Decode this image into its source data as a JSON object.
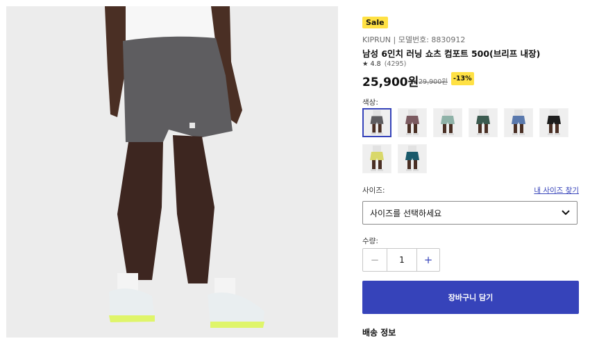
{
  "product": {
    "badge": "Sale",
    "brand_line": "KIPRUN | 모델번호: 8830912",
    "title": "남성 6인치 러닝 쇼츠 컴포트 500(브리프 내장)",
    "rating": "★ 4.8",
    "review_count": "(4295)",
    "price": "25,900원",
    "old_price": "29,900원",
    "discount": "-13%"
  },
  "color": {
    "label": "색상:",
    "swatches": [
      {
        "name": "swatch-1",
        "shorts": "#5e5d60",
        "selected": true
      },
      {
        "name": "swatch-2",
        "shorts": "#7b5a60",
        "selected": false
      },
      {
        "name": "swatch-3",
        "shorts": "#8fb2a8",
        "selected": false
      },
      {
        "name": "swatch-4",
        "shorts": "#3b5a4f",
        "selected": false
      },
      {
        "name": "swatch-5",
        "shorts": "#5a79ad",
        "selected": false
      },
      {
        "name": "swatch-6",
        "shorts": "#1c1c1c",
        "selected": false
      },
      {
        "name": "swatch-7",
        "shorts": "#d9d86a",
        "selected": false
      },
      {
        "name": "swatch-8",
        "shorts": "#1a5a6b",
        "selected": false
      }
    ]
  },
  "size": {
    "label": "사이즈:",
    "guide_link": "내 사이즈 찾기",
    "placeholder": "사이즈를 선택하세요"
  },
  "quantity": {
    "label": "수량:",
    "minus": "−",
    "value": "1",
    "plus": "+"
  },
  "cart_button": "장바구니 담기",
  "shipping_heading": "배송 정보",
  "colors": {
    "accent": "#3643ba",
    "sale_yellow": "#ffe144"
  }
}
